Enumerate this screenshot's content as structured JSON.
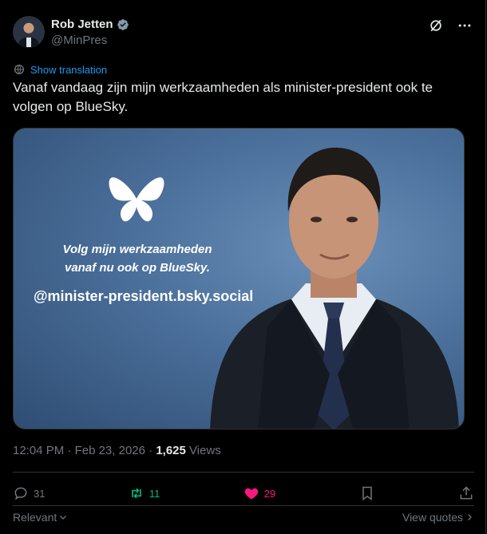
{
  "author": {
    "name": "Rob Jetten",
    "handle": "@MinPres",
    "verified": true
  },
  "top_icons": [
    "grok-icon",
    "more-options-icon"
  ],
  "translate": {
    "label": "Show translation"
  },
  "tweet": {
    "text": "Vanaf vandaag zijn mijn werkzaamheden als minister-president ook te volgen op BlueSky."
  },
  "media": {
    "line1": "Volg mijn werkzaamheden",
    "line2": "vanaf nu ook op BlueSky.",
    "handle": "@minister-president.bsky.social",
    "background_color": "#4a6f9a"
  },
  "meta": {
    "time": "12:04 PM",
    "date": "Feb 23, 2026",
    "views_count": "1,625",
    "views_label": "Views"
  },
  "actions": {
    "replies": "31",
    "reposts": "11",
    "likes": "29"
  },
  "bottom": {
    "sort_label": "Relevant",
    "quotes_label": "View quotes"
  },
  "colors": {
    "accent": "#1d9bf0",
    "repost": "#00ba7c",
    "like": "#f91880",
    "muted": "#71767b"
  }
}
